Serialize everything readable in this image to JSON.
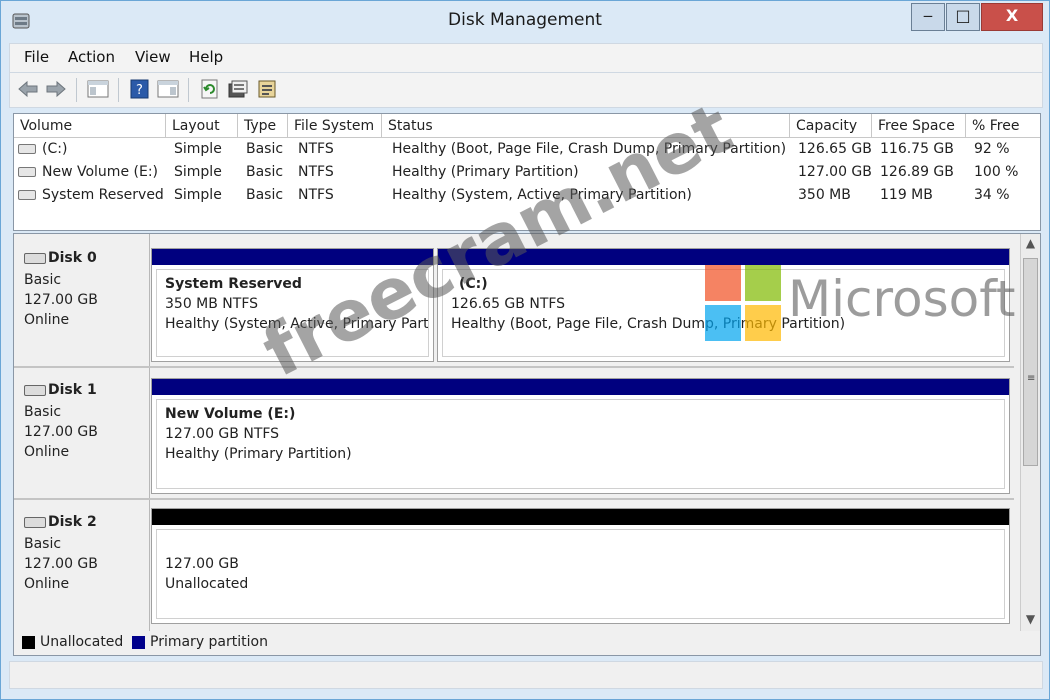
{
  "window": {
    "title": "Disk Management",
    "buttons": {
      "minimize": "‒",
      "maximize": "□",
      "close": "X"
    }
  },
  "menu": [
    "File",
    "Action",
    "View",
    "Help"
  ],
  "toolbar": [
    "back-arrow-icon",
    "forward-arrow-icon",
    "console-tree-icon",
    "help-icon",
    "action-pane-icon",
    "refresh-icon",
    "properties-icon",
    "export-list-icon"
  ],
  "volume_table": {
    "columns": [
      "Volume",
      "Layout",
      "Type",
      "File System",
      "Status",
      "Capacity",
      "Free Space",
      "% Free"
    ],
    "rows": [
      [
        "(C:)",
        "Simple",
        "Basic",
        "NTFS",
        "Healthy (Boot, Page File, Crash Dump, Primary Partition)",
        "126.65 GB",
        "116.75 GB",
        "92 %"
      ],
      [
        "New Volume (E:)",
        "Simple",
        "Basic",
        "NTFS",
        "Healthy (Primary Partition)",
        "127.00 GB",
        "126.89 GB",
        "100 %"
      ],
      [
        "System Reserved",
        "Simple",
        "Basic",
        "NTFS",
        "Healthy (System, Active, Primary Partition)",
        "350 MB",
        "119 MB",
        "34 %"
      ]
    ]
  },
  "disks": [
    {
      "name": "Disk 0",
      "type": "Basic",
      "size": "127.00 GB",
      "state": "Online",
      "partitions": [
        {
          "title": "System Reserved",
          "size": "350 MB NTFS",
          "status": "Healthy (System, Active, Primary Partit"
        },
        {
          "title": "(C:)",
          "size": "126.65 GB NTFS",
          "status": "Healthy (Boot, Page File, Crash Dump, Primary Partition)"
        }
      ]
    },
    {
      "name": "Disk 1",
      "type": "Basic",
      "size": "127.00 GB",
      "state": "Online",
      "partitions": [
        {
          "title": "New Volume  (E:)",
          "size": "127.00 GB NTFS",
          "status": "Healthy (Primary Partition)"
        }
      ]
    },
    {
      "name": "Disk 2",
      "type": "Basic",
      "size": "127.00 GB",
      "state": "Online",
      "partitions": [
        {
          "title": "",
          "size": "127.00 GB",
          "status": "Unallocated"
        }
      ]
    }
  ],
  "legend": [
    {
      "label": "Unallocated",
      "color": "#000000"
    },
    {
      "label": "Primary partition",
      "color": "#00008b"
    }
  ],
  "colors": {
    "primary": "#00007f",
    "unallocated": "#000000"
  },
  "watermark": {
    "text": "freecram.net",
    "brand": "Microsoft"
  }
}
